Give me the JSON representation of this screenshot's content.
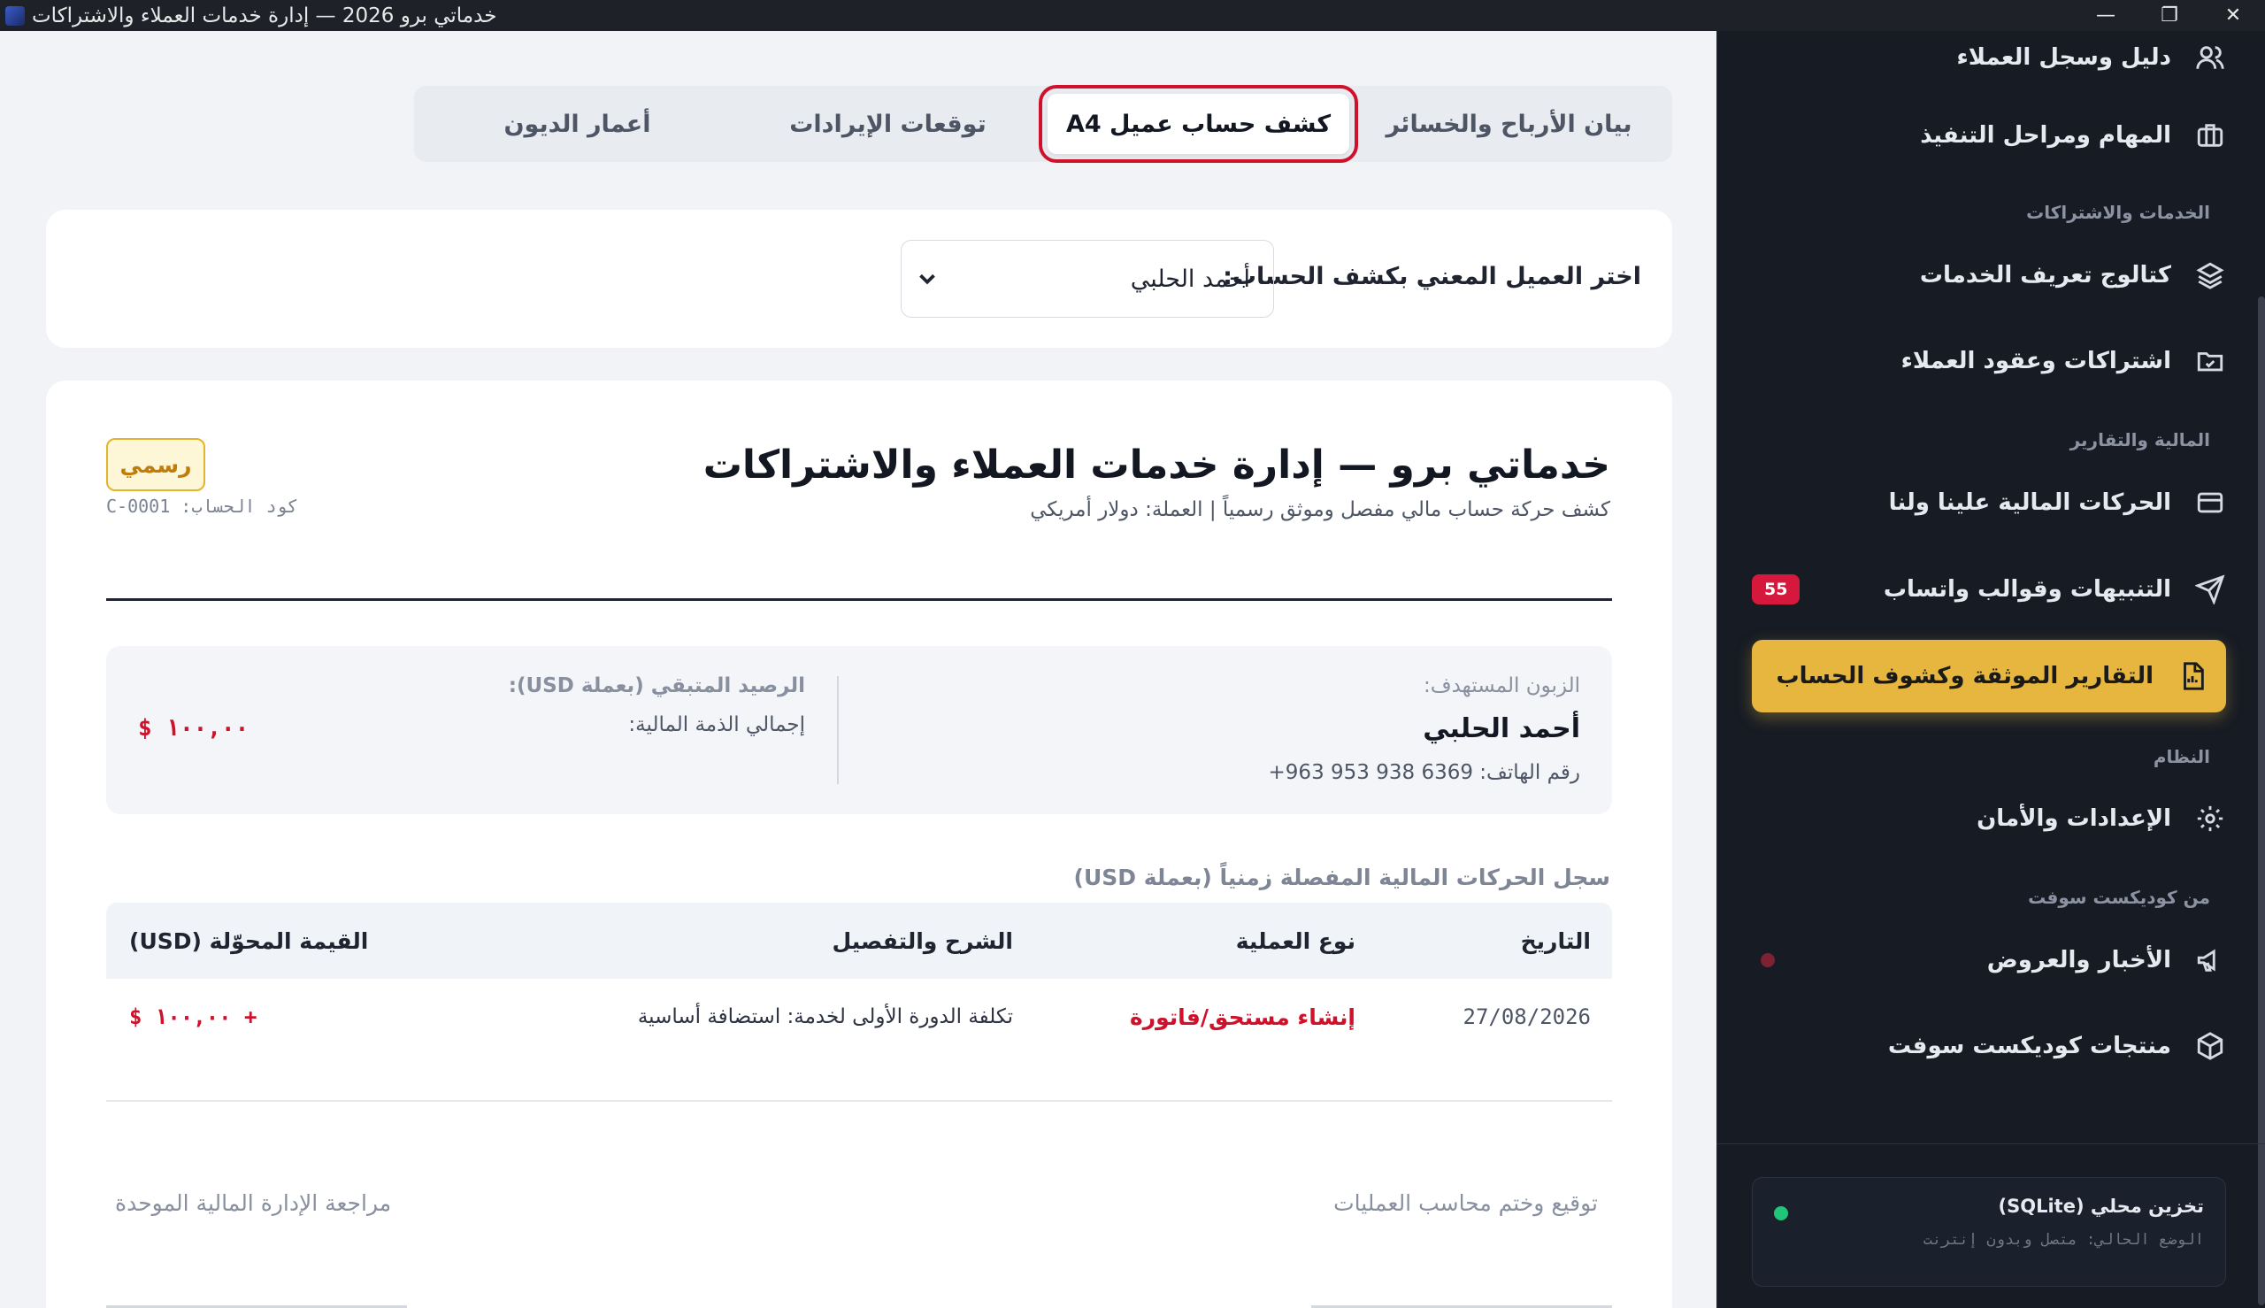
{
  "window": {
    "title": "خدماتي برو 2026 — إدارة خدمات العملاء والاشتراكات",
    "minimize": "—",
    "maximize": "❐",
    "close": "✕"
  },
  "sidebar": {
    "items": [
      {
        "label": "دليل وسجل العملاء",
        "icon": "users-icon"
      },
      {
        "label": "المهام ومراحل التنفيذ",
        "icon": "briefcase-icon"
      },
      {
        "section": "الخدمات والاشتراكات"
      },
      {
        "label": "كتالوج تعريف الخدمات",
        "icon": "layers-icon"
      },
      {
        "label": "اشتراكات وعقود العملاء",
        "icon": "folder-check-icon"
      },
      {
        "section": "المالية والتقارير"
      },
      {
        "label": "الحركات المالية علينا ولنا",
        "icon": "credit-card-icon"
      },
      {
        "label": "التنبيهات وقوالب واتساب",
        "icon": "send-icon",
        "badge": "55"
      },
      {
        "label": "التقارير الموثقة وكشوف الحساب",
        "icon": "report-file-icon",
        "active": true
      },
      {
        "section": "النظام"
      },
      {
        "label": "الإعدادات والأمان",
        "icon": "gear-icon"
      },
      {
        "section": "من كوديكست سوفت"
      },
      {
        "label": "الأخبار والعروض",
        "icon": "megaphone-icon"
      },
      {
        "label": "منتجات كوديكست سوفت",
        "icon": "box-icon"
      }
    ],
    "storage": {
      "title": "تخزين محلي (SQLite)",
      "status": "الوضع الحالي: متصل وبدون إنترنت",
      "status_color": "#1fc67a"
    }
  },
  "tabs": [
    {
      "label": "بيان الأرباح والخسائر",
      "active": false
    },
    {
      "label": "كشف حساب عميل A4",
      "active": true
    },
    {
      "label": "توقعات الإيرادات",
      "active": false
    },
    {
      "label": "أعمار الديون",
      "active": false
    }
  ],
  "selector": {
    "label": "اختر العميل المعني بكشف الحساب:",
    "value": "أحمد الحلبي"
  },
  "statement": {
    "title": "خدماتي برو — إدارة خدمات العملاء والاشتراكات",
    "subtitle": "كشف حركة حساب مالي مفصل وموثق رسمياً | العملة: دولار أمريكي",
    "official_badge": "رسمي",
    "account_code": "كود الحساب: C-0001",
    "customer_label": "الزبون المستهدف:",
    "customer_name": "أحمد الحلبي",
    "phone": "رقم الهاتف: 6369 938 953 963+",
    "balance_label": "الرصيد المتبقي (بعملة USD):",
    "total_label": "إجمالي الذمة المالية:",
    "balance_amount": "$ ١٠٠,٠٠",
    "transactions_heading": "سجل الحركات المالية المفصلة زمنياً (بعملة USD)",
    "table": {
      "headers": [
        "التاريخ",
        "نوع العملية",
        "الشرح والتفصيل",
        "القيمة المحوّلة (USD)"
      ],
      "rows": [
        {
          "date": "27/08/2026",
          "type": "إنشاء مستحق/فاتورة",
          "description": "تكلفة الدورة الأولى لخدمة: استضافة أساسية",
          "amount": "+ ١٠٠,٠٠ $"
        }
      ]
    },
    "signature_right": "توقيع وختم محاسب العمليات",
    "signature_left": "مراجعة الإدارة المالية الموحدة"
  },
  "colors": {
    "accent": "#e6b63e",
    "danger": "#d0112b",
    "sidebar_bg": "#161b24"
  }
}
